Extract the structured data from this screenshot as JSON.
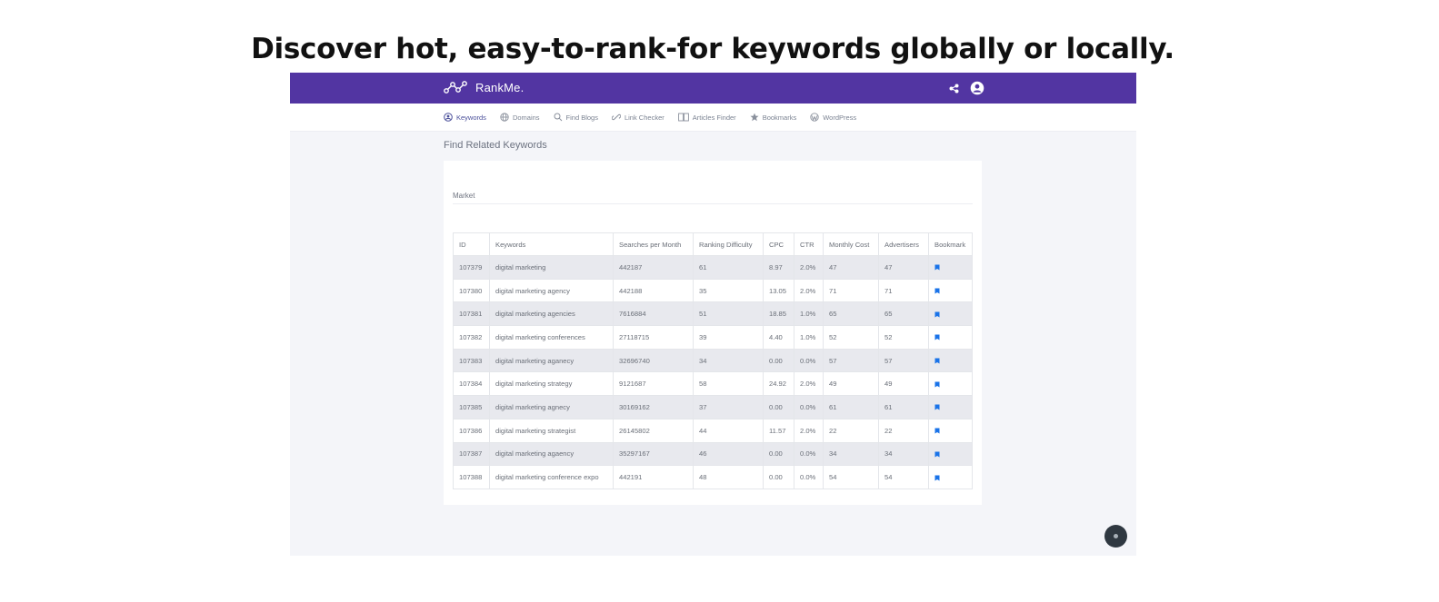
{
  "headline": "Discover hot, easy-to-rank-for keywords globally or locally.",
  "app": {
    "brand": "RankMe.",
    "icons": {
      "logo": "molecule-logo-icon",
      "share": "share-icon",
      "account": "user-circle-icon"
    },
    "accent": "#5235a2"
  },
  "nav": {
    "items": [
      {
        "label": "Keywords",
        "icon": "user-circle-icon",
        "active": true
      },
      {
        "label": "Domains",
        "icon": "globe-icon"
      },
      {
        "label": "Find Blogs",
        "icon": "search-icon"
      },
      {
        "label": "Link Checker",
        "icon": "link-icon"
      },
      {
        "label": "Articles Finder",
        "icon": "book-icon"
      },
      {
        "label": "Bookmarks",
        "icon": "star-icon"
      },
      {
        "label": "WordPress",
        "icon": "wordpress-icon"
      }
    ]
  },
  "page": {
    "title": "Find Related Keywords",
    "market_label": "Market"
  },
  "table": {
    "headers": [
      "ID",
      "Keywords",
      "Searches per Month",
      "Ranking Difficulty",
      "CPC",
      "CTR",
      "Monthly Cost",
      "Advertisers",
      "Bookmark"
    ],
    "rows": [
      [
        "107379",
        "digital marketing",
        "442187",
        "61",
        "8.97",
        "2.0%",
        "47",
        "47"
      ],
      [
        "107380",
        "digital marketing agency",
        "442188",
        "35",
        "13.05",
        "2.0%",
        "71",
        "71"
      ],
      [
        "107381",
        "digital marketing agencies",
        "7616884",
        "51",
        "18.85",
        "1.0%",
        "65",
        "65"
      ],
      [
        "107382",
        "digital marketing conferences",
        "27118715",
        "39",
        "4.40",
        "1.0%",
        "52",
        "52"
      ],
      [
        "107383",
        "digital marketing aganecy",
        "32696740",
        "34",
        "0.00",
        "0.0%",
        "57",
        "57"
      ],
      [
        "107384",
        "digital marketing strategy",
        "9121687",
        "58",
        "24.92",
        "2.0%",
        "49",
        "49"
      ],
      [
        "107385",
        "digital marketing agnecy",
        "30169162",
        "37",
        "0.00",
        "0.0%",
        "61",
        "61"
      ],
      [
        "107386",
        "digital marketing strategist",
        "26145802",
        "44",
        "11.57",
        "2.0%",
        "22",
        "22"
      ],
      [
        "107387",
        "digital marketing agaency",
        "35297167",
        "46",
        "0.00",
        "0.0%",
        "34",
        "34"
      ],
      [
        "107388",
        "digital marketing conference expo",
        "442191",
        "48",
        "0.00",
        "0.0%",
        "54",
        "54"
      ]
    ],
    "bookmark_icon": "bookmark-icon",
    "bookmark_color": "#1a73e8"
  },
  "chat": {
    "icon": "chat-bubble-icon"
  }
}
